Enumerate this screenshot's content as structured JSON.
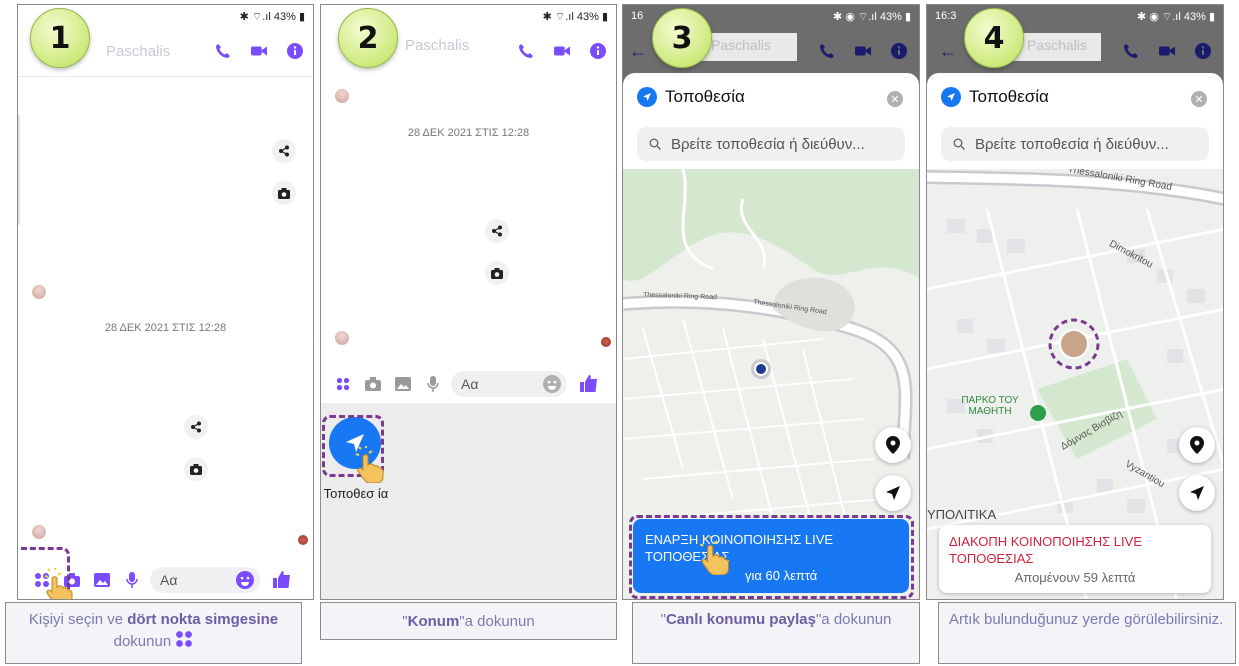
{
  "step_numbers": [
    "1",
    "2",
    "3",
    "4"
  ],
  "status": {
    "battery": "43%",
    "time_p3": "16",
    "time_p4": "16:3"
  },
  "chat": {
    "contact_name": "Paschalis",
    "date_separator": "28 ΔΕΚ 2021 ΣΤΙΣ 12:28",
    "message_placeholder": "Αα"
  },
  "attach_menu": {
    "location_label": "Τοποθεσ ία"
  },
  "location_sheet": {
    "title": "Τοποθεσία",
    "search_placeholder": "Βρείτε τοποθεσία ή διεύθυν...",
    "start_live_label": "ΕΝΑΡΞΗ ΚΟΙΝΟΠΟΙΗΣΗΣ LIVE ΤΟΠΟΘΕΣΙΑΣ",
    "start_live_duration": "για 60 λεπτά",
    "stop_live_label": "ΔΙΑΚΟΠΗ ΚΟΙΝΟΠΟΙΗΣΗΣ LIVE ΤΟΠΟΘΕΣΙΑΣ",
    "stop_live_remaining": "Απομένουν 59 λεπτά"
  },
  "map_labels": {
    "ring_road_p3_a": "Thessaloniki Ring Road",
    "ring_road_p3_b": "Thessaloniki Ring Road",
    "ring_road_p4": "Thessaloniki Ring Road",
    "dimokritou": "Dimokritou",
    "park": "ΠΑΡΚΟ ΤΟΥ ΜΑΘΗΤΗ",
    "street": "Δόμνας Βισβίζη",
    "vyzantiou": "Vyzantiou",
    "district": "ΥΠΟΛΙΤΙΚΑ"
  },
  "captions": {
    "c1_prefix": "Kişiyi seçin ve",
    "c1_bold": "dört nokta simgesine",
    "c1_suffix": "dokunun",
    "c2_bold": "Konum",
    "c2_suffix": "\"a dokunun",
    "c2_open": "\"",
    "c3_open": "\"",
    "c3_bold": "Canlı konumu paylaş",
    "c3_suffix": "\"a dokunun",
    "c4": "Artık bulunduğunuz yerde görülebilirsiniz."
  },
  "colors": {
    "messenger_purple": "#7b4cff",
    "messenger_blue": "#1877f2",
    "stop_red": "#d0213a",
    "highlight_dash": "#7a3a8f",
    "badge_green": "#cdea7c"
  }
}
